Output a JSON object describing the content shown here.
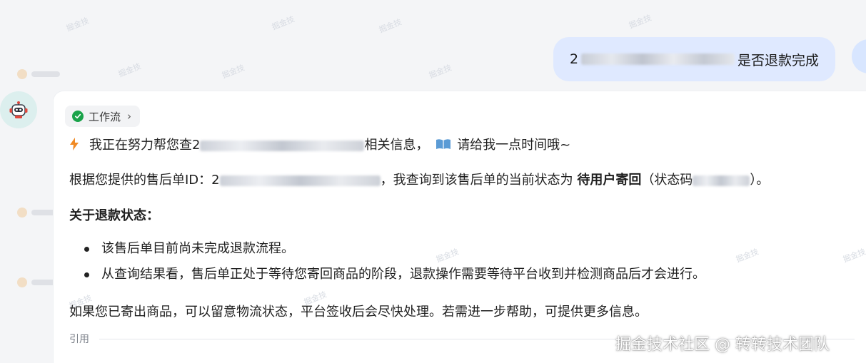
{
  "user_message": {
    "prefix": "2",
    "suffix": "是否退款完成"
  },
  "workflow": {
    "label": "工作流"
  },
  "bot": {
    "status_line": {
      "prefix": "我正在努力帮您查2",
      "middle": "相关信息，",
      "suffix": "请给我一点时间哦~"
    },
    "answer_line": {
      "prefix": "根据您提供的售后单ID：2",
      "middle": "，我查询到该售后单的当前状态为 ",
      "status": "待用户寄回",
      "suffix_a": "（状态码",
      "suffix_b": "）。"
    },
    "section_heading": "关于退款状态：",
    "bullets": [
      "该售后单目前尚未完成退款流程。",
      "从查询结果看，售后单正处于等待您寄回商品的阶段，退款操作需要等待平台收到并检测商品后才会进行。"
    ],
    "closing": "如果您已寄出商品，可以留意物流状态，平台签收后会尽快处理。若需进一步帮助，可提供更多信息。",
    "citation_label": "引用"
  },
  "watermark": "掘金技术社区 @ 转转技术团队",
  "colors": {
    "user_bubble": "#dfe9ff",
    "check": "#1aa34a",
    "bolt": "#f08a24"
  }
}
